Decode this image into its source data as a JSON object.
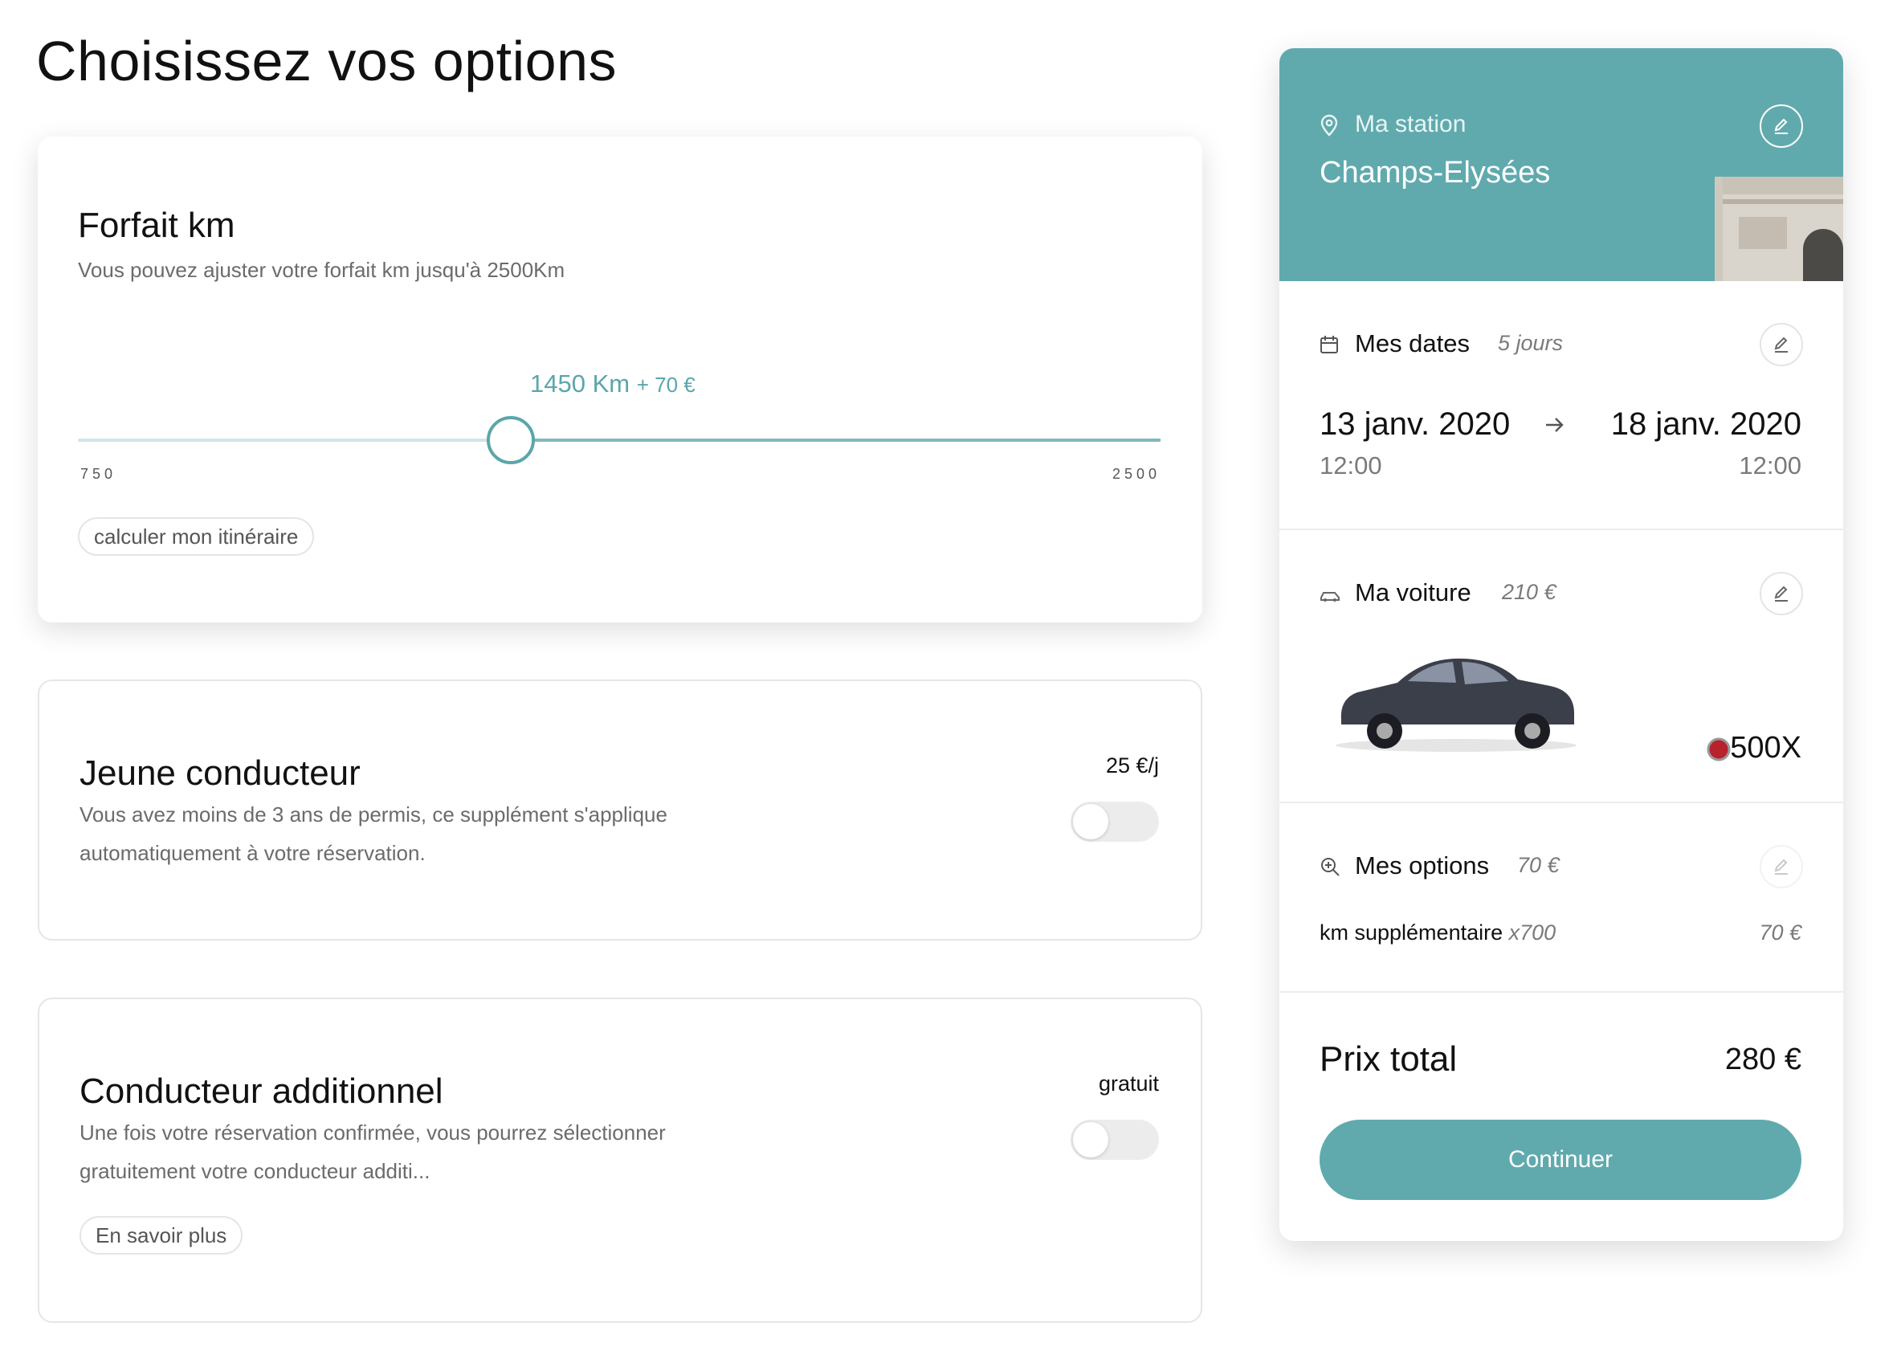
{
  "page": {
    "title": "Choisissez vos options"
  },
  "forfait": {
    "title": "Forfait km",
    "subtitle": "Vous pouvez ajuster votre forfait km jusqu'à 2500Km",
    "value_label": "1450 Km",
    "extra_label": "+ 70 €",
    "min_label": "750",
    "max_label": "2500",
    "min": 750,
    "max": 2500,
    "value": 1450,
    "route_button": "calculer mon itinéraire"
  },
  "jeune": {
    "title": "Jeune conducteur",
    "price": "25 €/j",
    "description": "Vous avez moins de 3 ans de permis, ce supplément s'applique automatiquement à votre réservation.",
    "enabled": false
  },
  "additionnel": {
    "title": "Conducteur additionnel",
    "price": "gratuit",
    "description": "Une fois votre réservation confirmée, vous pourrez sélectionner gratuitement votre conducteur additi...",
    "learn_more": "En savoir plus",
    "enabled": false
  },
  "summary": {
    "station_label": "Ma station",
    "station_name": "Champs-Elysées",
    "dates_label": "Mes dates",
    "dates_duration": "5 jours",
    "start_date": "13 janv. 2020",
    "start_time": "12:00",
    "end_date": "18 janv. 2020",
    "end_time": "12:00",
    "car_label": "Ma voiture",
    "car_price": "210 €",
    "car_model": "500X",
    "options_label": "Mes options",
    "options_price": "70 €",
    "option_name": "km supplémentaire",
    "option_qty": "x700",
    "option_price": "70 €",
    "total_label": "Prix total",
    "total_value": "280 €",
    "continue": "Continuer"
  },
  "colors": {
    "accent": "#60aaae",
    "slider_track": "#cfe6e7"
  },
  "icons": [
    "pin-icon",
    "edit-icon",
    "calendar-icon",
    "arrow-right-icon",
    "car-icon",
    "zoom-plus-icon",
    "fiat-logo-icon"
  ]
}
